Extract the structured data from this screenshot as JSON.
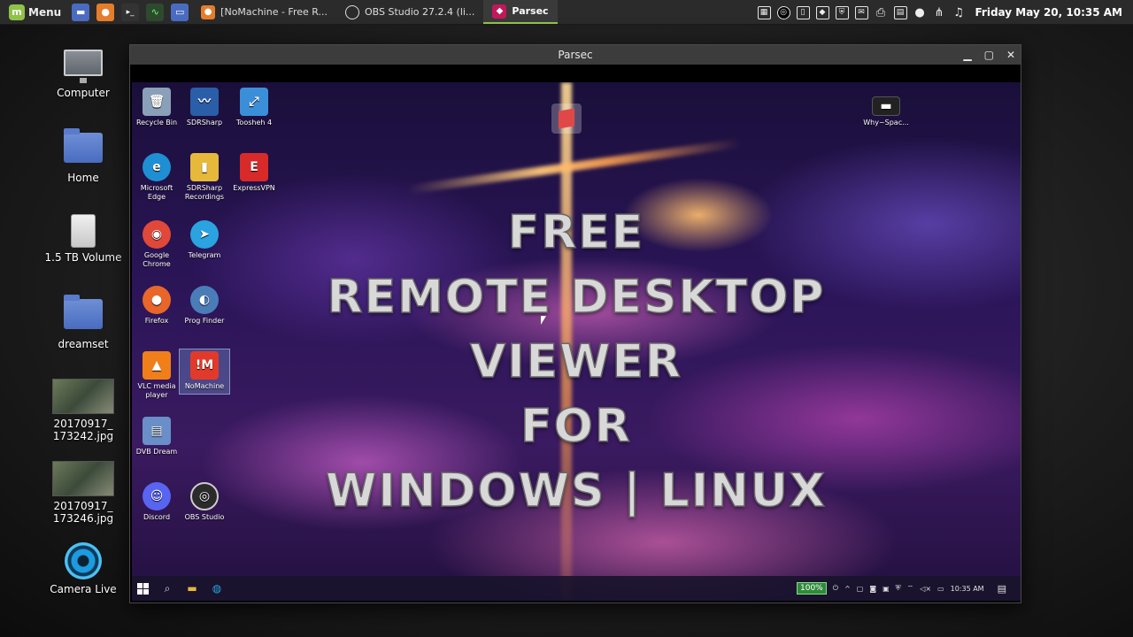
{
  "top_panel": {
    "menu_label": "Menu",
    "tasks": [
      {
        "label": "[NoMachine - Free R...",
        "icon_color": "#e57d2a"
      },
      {
        "label": "OBS Studio 27.2.4 (li...",
        "icon_color": "#555555"
      },
      {
        "label": "Parsec",
        "icon_color": "#c2185b"
      }
    ],
    "clock": "Friday May 20, 10:35 AM"
  },
  "desktop_icons": [
    {
      "label": "Computer"
    },
    {
      "label": "Home"
    },
    {
      "label": "1.5 TB Volume"
    },
    {
      "label": "dreamset"
    },
    {
      "label": "20170917_\n173242.jpg"
    },
    {
      "label": "20170917_\n173246.jpg"
    },
    {
      "label": "Camera Live"
    }
  ],
  "window": {
    "title": "Parsec"
  },
  "remote": {
    "icons": [
      {
        "label": "Recycle Bin",
        "glyph": "🗑",
        "color": "#8aa0b8"
      },
      {
        "label": "SDRSharp",
        "glyph": "〰",
        "color": "#2a5ea8"
      },
      {
        "label": "Toosheh 4",
        "glyph": "⤢",
        "color": "#3b8fd8"
      },
      {
        "label": "Microsoft Edge",
        "glyph": "e",
        "color": "#1f8fd3"
      },
      {
        "label": "SDRSharp Recordings",
        "glyph": "▮",
        "color": "#e6b93a"
      },
      {
        "label": "ExpressVPN",
        "glyph": "E",
        "color": "#d92a2a"
      },
      {
        "label": "Google Chrome",
        "glyph": "◉",
        "color": "#e0483a"
      },
      {
        "label": "Telegram",
        "glyph": "➤",
        "color": "#2aa3e0"
      },
      {
        "label": "Firefox",
        "glyph": "●",
        "color": "#e8662a"
      },
      {
        "label": "Prog Finder",
        "glyph": "◐",
        "color": "#4a7db8"
      },
      {
        "label": "VLC media player",
        "glyph": "▲",
        "color": "#f07f1a"
      },
      {
        "label": "NoMachine",
        "glyph": "!M",
        "color": "#e23a2a"
      },
      {
        "label": "DVB Dream",
        "glyph": "▤",
        "color": "#6a8fc8"
      },
      {
        "label": "Discord",
        "glyph": "☺",
        "color": "#5865f2"
      },
      {
        "label": "OBS Studio",
        "glyph": "◎",
        "color": "#2b2b2b"
      },
      {
        "label": "Why~Spac...",
        "glyph": "▬",
        "color": "#222222"
      }
    ],
    "overlay_lines": [
      "FREE",
      "REMOTE DESKTOP",
      "VIEWER",
      "FOR",
      "WINDOWS | LINUX"
    ],
    "taskbar": {
      "battery": "100%",
      "time": "10:35 AM"
    }
  }
}
